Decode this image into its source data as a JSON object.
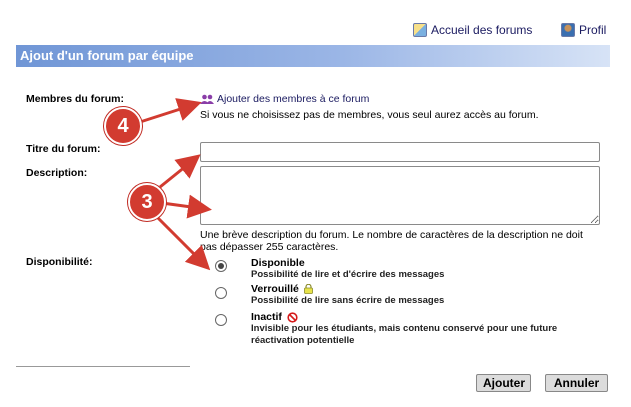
{
  "toplinks": {
    "forums_home": "Accueil des forums",
    "profile": "Profil"
  },
  "header": {
    "title": "Ajout d'un forum par équipe"
  },
  "form": {
    "members_label": "Membres du forum:",
    "add_members_link": "Ajouter des membres à ce forum",
    "members_note": "Si vous ne choisissez pas de membres, vous seul aurez accès au forum.",
    "title_label": "Titre du forum:",
    "title_value": "",
    "description_label": "Description:",
    "description_value": "",
    "description_help_line1": "Une brève description du forum. Le nombre de caractères de la description ne doit",
    "description_help_line2": "pas dépasser 255 caractères.",
    "availability_label": "Disponibilité:",
    "options": [
      {
        "title": "Disponible",
        "desc1": "Possibilité de lire et d'écrire des messages",
        "desc2": "",
        "checked": true
      },
      {
        "title": "Verrouillé",
        "desc1": "Possibilité de lire sans écrire de messages",
        "desc2": "",
        "checked": false
      },
      {
        "title": "Inactif",
        "desc1": "Invisible pour les étudiants, mais contenu conservé pour une future",
        "desc2": "réactivation potentielle",
        "checked": false
      }
    ]
  },
  "buttons": {
    "add": "Ajouter",
    "cancel": "Annuler"
  },
  "annotations": {
    "badge_4": "4",
    "badge_3": "3",
    "color": "#d23b30"
  },
  "colors": {
    "header_start": "#7096d6",
    "header_end": "#d7e3f6",
    "link": "#1a1a60"
  },
  "icons": [
    "forums-home-icon",
    "profile-icon",
    "members-icon",
    "lock-icon",
    "forbidden-icon"
  ]
}
